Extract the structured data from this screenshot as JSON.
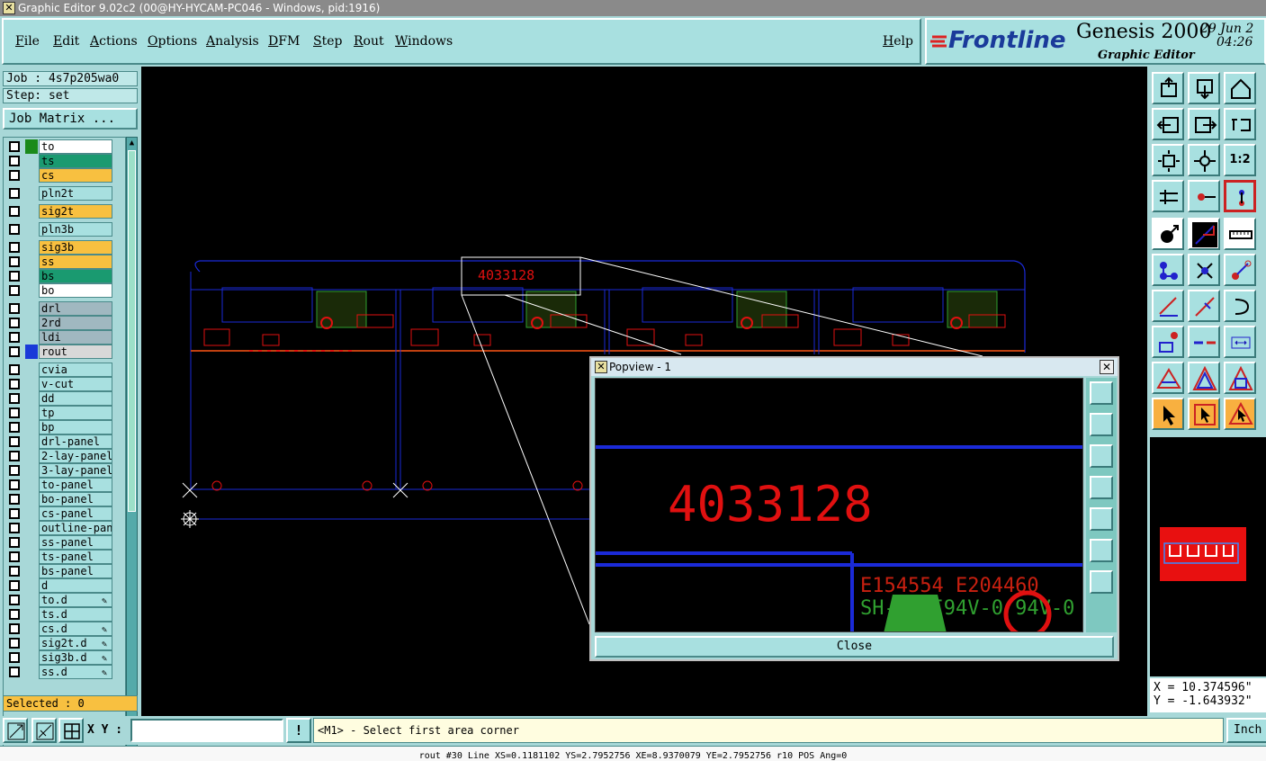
{
  "window": {
    "title": "Graphic Editor 9.02c2 (00@HY-HYCAM-PC046 - Windows, pid:1916)"
  },
  "menu": {
    "items": [
      "File",
      "Edit",
      "Actions",
      "Options",
      "Analysis",
      "DFM",
      "Step",
      "Rout",
      "Windows"
    ],
    "help": "Help"
  },
  "brand": {
    "logo": "Frontline",
    "product": "Genesis 2000",
    "subtitle": "Graphic Editor",
    "date": "29 Jun 2",
    "time": "04:26"
  },
  "job": {
    "job_line": "Job : 4s7p205wa0",
    "step_line": "Step: set",
    "matrix_button": "Job Matrix ..."
  },
  "layers": [
    {
      "name": "to",
      "swatch": "#1a8a1a",
      "bg": "#ffffff",
      "mark": ""
    },
    {
      "name": "ts",
      "swatch": "#a8d8d8",
      "bg": "#1a9a70",
      "mark": ""
    },
    {
      "name": "cs",
      "swatch": "#a8d8d8",
      "bg": "#f8c040",
      "mark": ""
    },
    {
      "name": "pln2t",
      "swatch": "#a8d8d8",
      "bg": "#a8e0e0",
      "mark": ""
    },
    {
      "name": "sig2t",
      "swatch": "#a8d8d8",
      "bg": "#f8c040",
      "mark": ""
    },
    {
      "name": "pln3b",
      "swatch": "#a8d8d8",
      "bg": "#a8e0e0",
      "mark": ""
    },
    {
      "name": "sig3b",
      "swatch": "#a8d8d8",
      "bg": "#f8c040",
      "mark": ""
    },
    {
      "name": "ss",
      "swatch": "#a8d8d8",
      "bg": "#f8c040",
      "mark": ""
    },
    {
      "name": "bs",
      "swatch": "#a8d8d8",
      "bg": "#1a9a70",
      "mark": ""
    },
    {
      "name": "bo",
      "swatch": "#a8d8d8",
      "bg": "#ffffff",
      "mark": ""
    },
    {
      "name": "drl",
      "swatch": "#a8d8d8",
      "bg": "#a0b8c0",
      "mark": ""
    },
    {
      "name": "2rd",
      "swatch": "#a8d8d8",
      "bg": "#a0b8c0",
      "mark": ""
    },
    {
      "name": "ldi",
      "swatch": "#a8d8d8",
      "bg": "#a0b8c0",
      "mark": ""
    },
    {
      "name": "rout",
      "swatch": "#1a3ad8",
      "bg": "#d8d8d8",
      "mark": ""
    },
    {
      "name": "cvia",
      "swatch": "#a8d8d8",
      "bg": "#a8e0e0",
      "mark": ""
    },
    {
      "name": "v-cut",
      "swatch": "#a8d8d8",
      "bg": "#a8e0e0",
      "mark": ""
    },
    {
      "name": "dd",
      "swatch": "#a8d8d8",
      "bg": "#a8e0e0",
      "mark": ""
    },
    {
      "name": "tp",
      "swatch": "#a8d8d8",
      "bg": "#a8e0e0",
      "mark": ""
    },
    {
      "name": "bp",
      "swatch": "#a8d8d8",
      "bg": "#a8e0e0",
      "mark": ""
    },
    {
      "name": "drl-panel",
      "swatch": "#a8d8d8",
      "bg": "#a8e0e0",
      "mark": ""
    },
    {
      "name": "2-lay-panel",
      "swatch": "#a8d8d8",
      "bg": "#a8e0e0",
      "mark": ""
    },
    {
      "name": "3-lay-panel",
      "swatch": "#a8d8d8",
      "bg": "#a8e0e0",
      "mark": ""
    },
    {
      "name": "to-panel",
      "swatch": "#a8d8d8",
      "bg": "#a8e0e0",
      "mark": ""
    },
    {
      "name": "bo-panel",
      "swatch": "#a8d8d8",
      "bg": "#a8e0e0",
      "mark": ""
    },
    {
      "name": "cs-panel",
      "swatch": "#a8d8d8",
      "bg": "#a8e0e0",
      "mark": ""
    },
    {
      "name": "outline-panel",
      "swatch": "#a8d8d8",
      "bg": "#a8e0e0",
      "mark": ""
    },
    {
      "name": "ss-panel",
      "swatch": "#a8d8d8",
      "bg": "#a8e0e0",
      "mark": ""
    },
    {
      "name": "ts-panel",
      "swatch": "#a8d8d8",
      "bg": "#a8e0e0",
      "mark": ""
    },
    {
      "name": "bs-panel",
      "swatch": "#a8d8d8",
      "bg": "#a8e0e0",
      "mark": ""
    },
    {
      "name": "d",
      "swatch": "#a8d8d8",
      "bg": "#a8e0e0",
      "mark": ""
    },
    {
      "name": "to.d",
      "swatch": "#a8d8d8",
      "bg": "#a8e0e0",
      "mark": "✎"
    },
    {
      "name": "ts.d",
      "swatch": "#a8d8d8",
      "bg": "#a8e0e0",
      "mark": ""
    },
    {
      "name": "cs.d",
      "swatch": "#a8d8d8",
      "bg": "#a8e0e0",
      "mark": "✎"
    },
    {
      "name": "sig2t.d",
      "swatch": "#a8d8d8",
      "bg": "#a8e0e0",
      "mark": "✎"
    },
    {
      "name": "sig3b.d",
      "swatch": "#a8d8d8",
      "bg": "#a8e0e0",
      "mark": "✎"
    },
    {
      "name": "ss.d",
      "swatch": "#a8d8d8",
      "bg": "#a8e0e0",
      "mark": "✎"
    }
  ],
  "selected": "Selected : 0",
  "canvas": {
    "label": "4033128"
  },
  "popview": {
    "title": "Popview - 1",
    "label": "4033128",
    "text1": "E154554 E204460",
    "text2": "SH-MUII94V-0 94V-0",
    "close": "Close"
  },
  "coords": {
    "x": "X = 10.374596\"",
    "y": "Y = -1.643932\""
  },
  "bottom": {
    "xy_label": "X Y :",
    "xy_value": "",
    "prompt": "<M1> - Select first area corner",
    "units": "Inch",
    "status": "rout #30 Line XS=0.1181102 YS=2.7952756 XE=8.9370079 YE=2.7952756 r10 POS Ang=0"
  },
  "colors": {
    "accent": "#a8e0e0",
    "canvas": "#000000",
    "outline": "#1a2ad8",
    "copper": "#e01010",
    "silk": "#30a030"
  }
}
